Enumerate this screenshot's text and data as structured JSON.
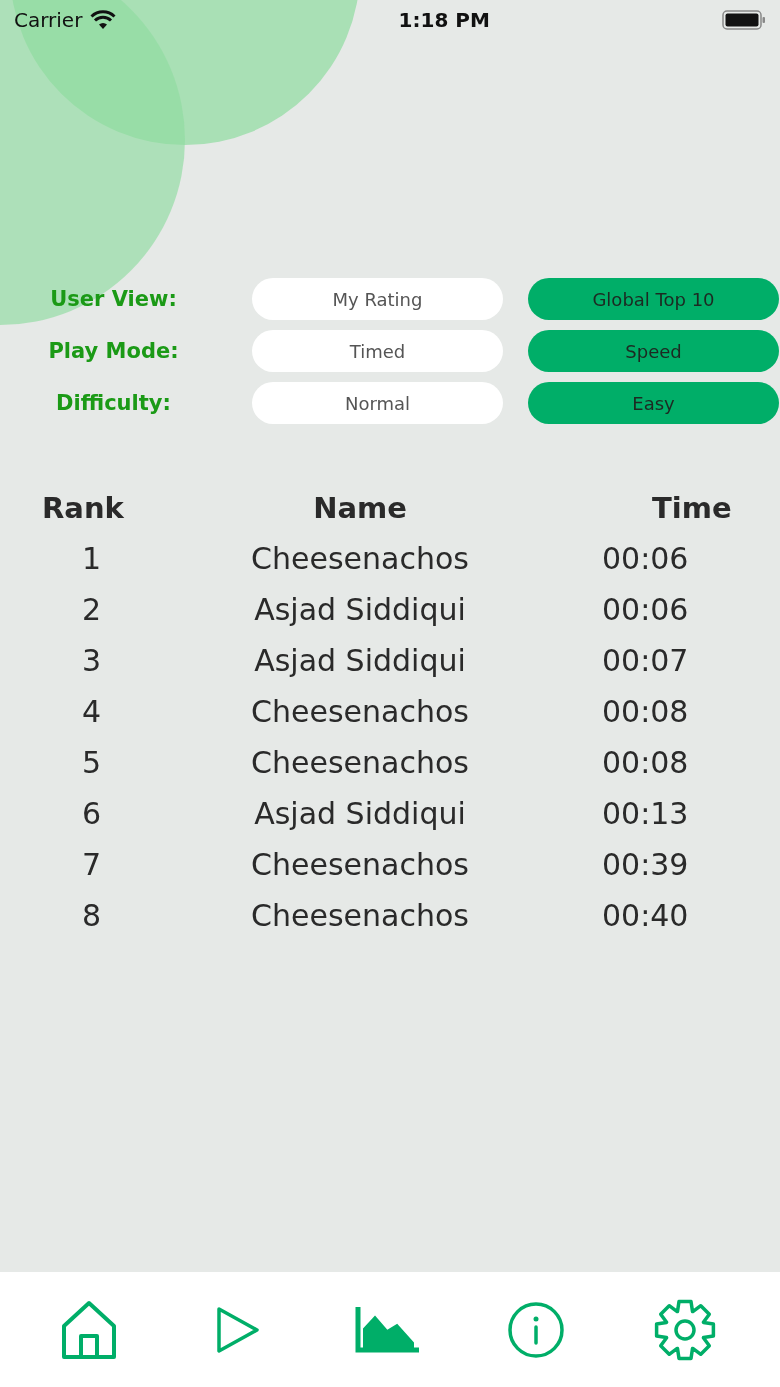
{
  "status_bar": {
    "carrier": "Carrier",
    "time": "1:18 PM"
  },
  "filters": [
    {
      "label": "User View:",
      "options": [
        {
          "label": "My Rating",
          "selected": false
        },
        {
          "label": "Global Top 10",
          "selected": true
        }
      ]
    },
    {
      "label": "Play Mode:",
      "options": [
        {
          "label": "Timed",
          "selected": false
        },
        {
          "label": "Speed",
          "selected": true
        }
      ]
    },
    {
      "label": "Difficulty:",
      "options": [
        {
          "label": "Normal",
          "selected": false
        },
        {
          "label": "Easy",
          "selected": true
        }
      ]
    }
  ],
  "table": {
    "columns": [
      "Rank",
      "Name",
      "Time"
    ],
    "rows": [
      [
        "1",
        "Cheesenachos",
        "00:06"
      ],
      [
        "2",
        "Asjad Siddiqui",
        "00:06"
      ],
      [
        "3",
        "Asjad Siddiqui",
        "00:07"
      ],
      [
        "4",
        "Cheesenachos",
        "00:08"
      ],
      [
        "5",
        "Cheesenachos",
        "00:08"
      ],
      [
        "6",
        "Asjad Siddiqui",
        "00:13"
      ],
      [
        "7",
        "Cheesenachos",
        "00:39"
      ],
      [
        "8",
        "Cheesenachos",
        "00:40"
      ]
    ]
  },
  "tab_bar": [
    {
      "kind": "home",
      "selected": false
    },
    {
      "kind": "play",
      "selected": false
    },
    {
      "kind": "chart",
      "selected": true
    },
    {
      "kind": "info",
      "selected": false
    },
    {
      "kind": "settings",
      "selected": false
    }
  ]
}
